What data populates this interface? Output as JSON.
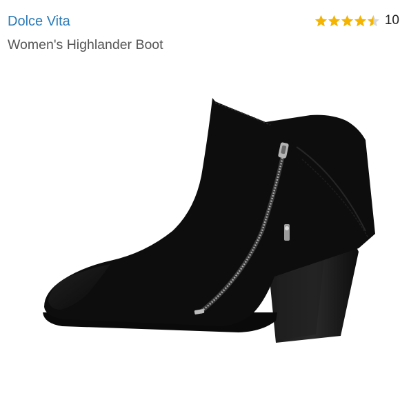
{
  "product": {
    "brand": "Dolce Vita",
    "name": "Women's Highlander Boot",
    "rating": 4.5,
    "review_count": "10",
    "image_icon": "black-suede-ankle-boot-with-side-zipper"
  },
  "colors": {
    "brand_link": "#2a7ab8",
    "star": "#f4b400",
    "star_empty": "#d8d8d8",
    "name_text": "#555555"
  }
}
